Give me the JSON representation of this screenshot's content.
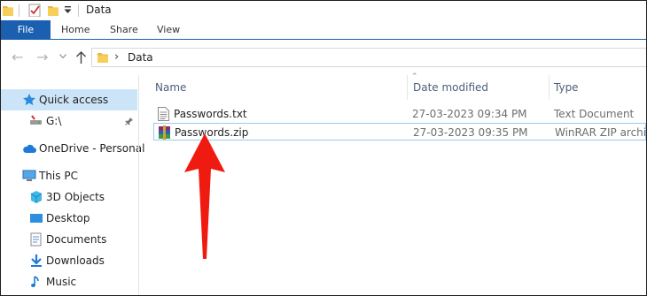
{
  "window": {
    "title": "Data"
  },
  "ribbon": {
    "tabs": [
      {
        "label": "File",
        "active": true
      },
      {
        "label": "Home"
      },
      {
        "label": "Share"
      },
      {
        "label": "View"
      }
    ]
  },
  "address": {
    "path": "Data"
  },
  "sidebar": {
    "items": [
      {
        "label": "Quick access",
        "icon": "star-icon",
        "selected": true
      },
      {
        "label": "G:\\",
        "icon": "drive-icon",
        "pinned": true
      },
      {
        "label": "OneDrive - Personal",
        "icon": "cloud-icon"
      },
      {
        "label": "This PC",
        "icon": "computer-icon"
      },
      {
        "label": "3D Objects",
        "icon": "cube-icon"
      },
      {
        "label": "Desktop",
        "icon": "desktop-icon"
      },
      {
        "label": "Documents",
        "icon": "documents-icon"
      },
      {
        "label": "Downloads",
        "icon": "download-icon"
      },
      {
        "label": "Music",
        "icon": "music-icon"
      }
    ]
  },
  "columns": {
    "name": "Name",
    "date": "Date modified",
    "type": "Type"
  },
  "files": [
    {
      "name": "Passwords.txt",
      "date": "27-03-2023 09:34 PM",
      "type": "Text Document",
      "icon": "text-file-icon"
    },
    {
      "name": "Passwords.zip",
      "date": "27-03-2023 09:35 PM",
      "type": "WinRAR ZIP archive",
      "icon": "winrar-icon"
    }
  ],
  "colors": {
    "accent": "#1b5fb0",
    "selection": "#cce4f7",
    "annotation_arrow": "#f01b10"
  }
}
